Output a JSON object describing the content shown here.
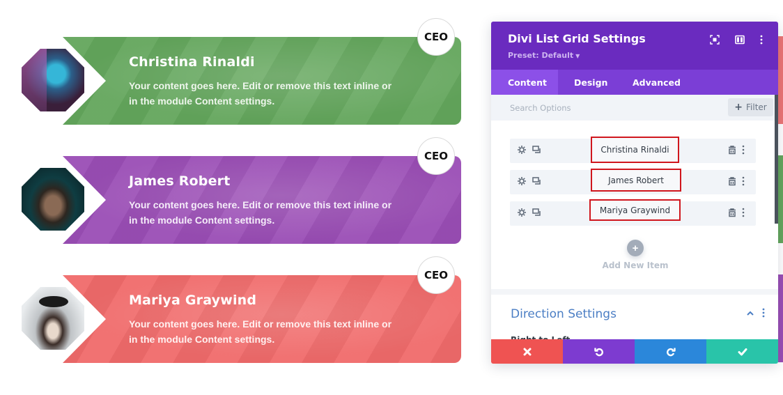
{
  "cards": [
    {
      "name": "Christina Rinaldi",
      "text": "Your content goes here. Edit or remove this text inline or in the module Content settings.",
      "badge": "CEO",
      "color": "#63a65c"
    },
    {
      "name": "James Robert",
      "text": "Your content goes here. Edit or remove this text inline or in the module Content settings.",
      "badge": "CEO",
      "color": "#9a4db5"
    },
    {
      "name": "Mariya Graywind",
      "text": "Your content goes here. Edit or remove this text inline or in the module Content settings.",
      "badge": "CEO",
      "color": "#f06a6a"
    }
  ],
  "panel": {
    "title": "Divi List Grid Settings",
    "preset": "Preset: Default",
    "header_icons": [
      "focus-mode-icon",
      "split-view-icon",
      "more-options-icon"
    ],
    "tabs": [
      {
        "label": "Content",
        "active": true
      },
      {
        "label": "Design",
        "active": false
      },
      {
        "label": "Advanced",
        "active": false
      }
    ],
    "search": {
      "placeholder": "Search Options",
      "value": ""
    },
    "filter_label": "Filter",
    "items": [
      {
        "label": "Christina Rinaldi"
      },
      {
        "label": "James Robert"
      },
      {
        "label": "Mariya Graywind"
      }
    ],
    "add_item_label": "Add New Item",
    "section": {
      "title": "Direction Settings",
      "field_label": "Right to Left"
    },
    "footer": {
      "cancel": "cancel",
      "undo": "undo",
      "redo": "redo",
      "save": "save"
    },
    "colors": {
      "header": "#6a2bbf",
      "tabs": "#7b3ed6",
      "cancel": "#ef5352",
      "undo": "#7d3bd0",
      "redo": "#2b87da",
      "save": "#29c4a9",
      "highlight_border": "#d0161d"
    }
  }
}
